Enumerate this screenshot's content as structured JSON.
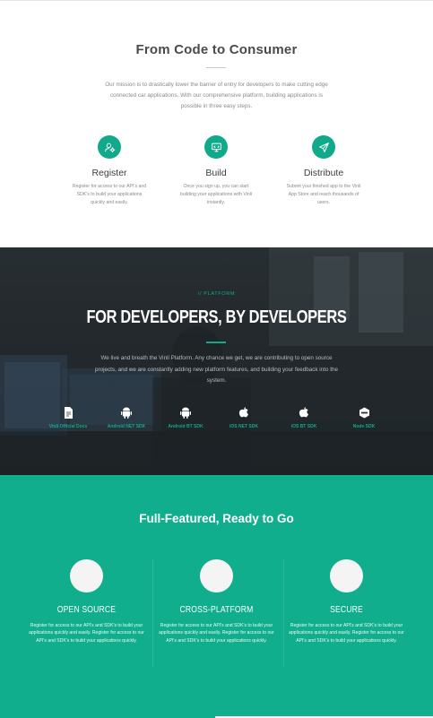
{
  "intro": {
    "title": "From Code to Consumer",
    "mission": "Our mission is to drastically lower the barrier of entry for developers to make cutting edge connected car applications. With our comprehensive platform, building applications is possible in three easy steps.",
    "steps": [
      {
        "icon": "user-settings-icon",
        "title": "Register",
        "text": "Register for access to our API's and SDK's to build your applications quickly and easily."
      },
      {
        "icon": "monitor-icon",
        "title": "Build",
        "text": "Once you sign up, you can start building your applications with Vinli instantly."
      },
      {
        "icon": "paper-plane-icon",
        "title": "Distribute",
        "text": "Submit your finished app to the Vinli App Store and reach thousands of users."
      }
    ]
  },
  "platform": {
    "eyebrow": "// PLATFORM",
    "title": "FOR DEVELOPERS, BY DEVELOPERS",
    "text": "We live and breath the Vinli Platform. Any chance we get, we are contributing to open source projects, and we are constantly adding new platform features, and building your feedback into the system.",
    "sdks": [
      {
        "icon": "document-icon",
        "label": "Vinli Official Docs"
      },
      {
        "icon": "android-icon",
        "label": "Android NET SDK"
      },
      {
        "icon": "android-icon",
        "label": "Android BT SDK"
      },
      {
        "icon": "apple-icon",
        "label": "iOS NET SDK"
      },
      {
        "icon": "apple-icon",
        "label": "iOS BT SDK"
      },
      {
        "icon": "nodejs-icon",
        "label": "Node SDK"
      }
    ],
    "accent": "#10a98a"
  },
  "features": {
    "title": "Full-Featured, Ready to Go",
    "items": [
      {
        "title": "OPEN SOURCE",
        "text": "Register for access to our API's and SDK's to build your applications quickly and easily. Register for access to our API's and SDK's to build your applications quickly."
      },
      {
        "title": "CROSS-PLATFORM",
        "text": "Register for access to our API's and SDK's to build your applications quickly and easily. Register for access to our API's and SDK's to build your applications quickly."
      },
      {
        "title": "SECURE",
        "text": "Register for access to our API's and SDK's to build your applications quickly and easily. Register for access to our API's and SDK's to build your applications quickly."
      }
    ],
    "background": "#10ae8c"
  }
}
